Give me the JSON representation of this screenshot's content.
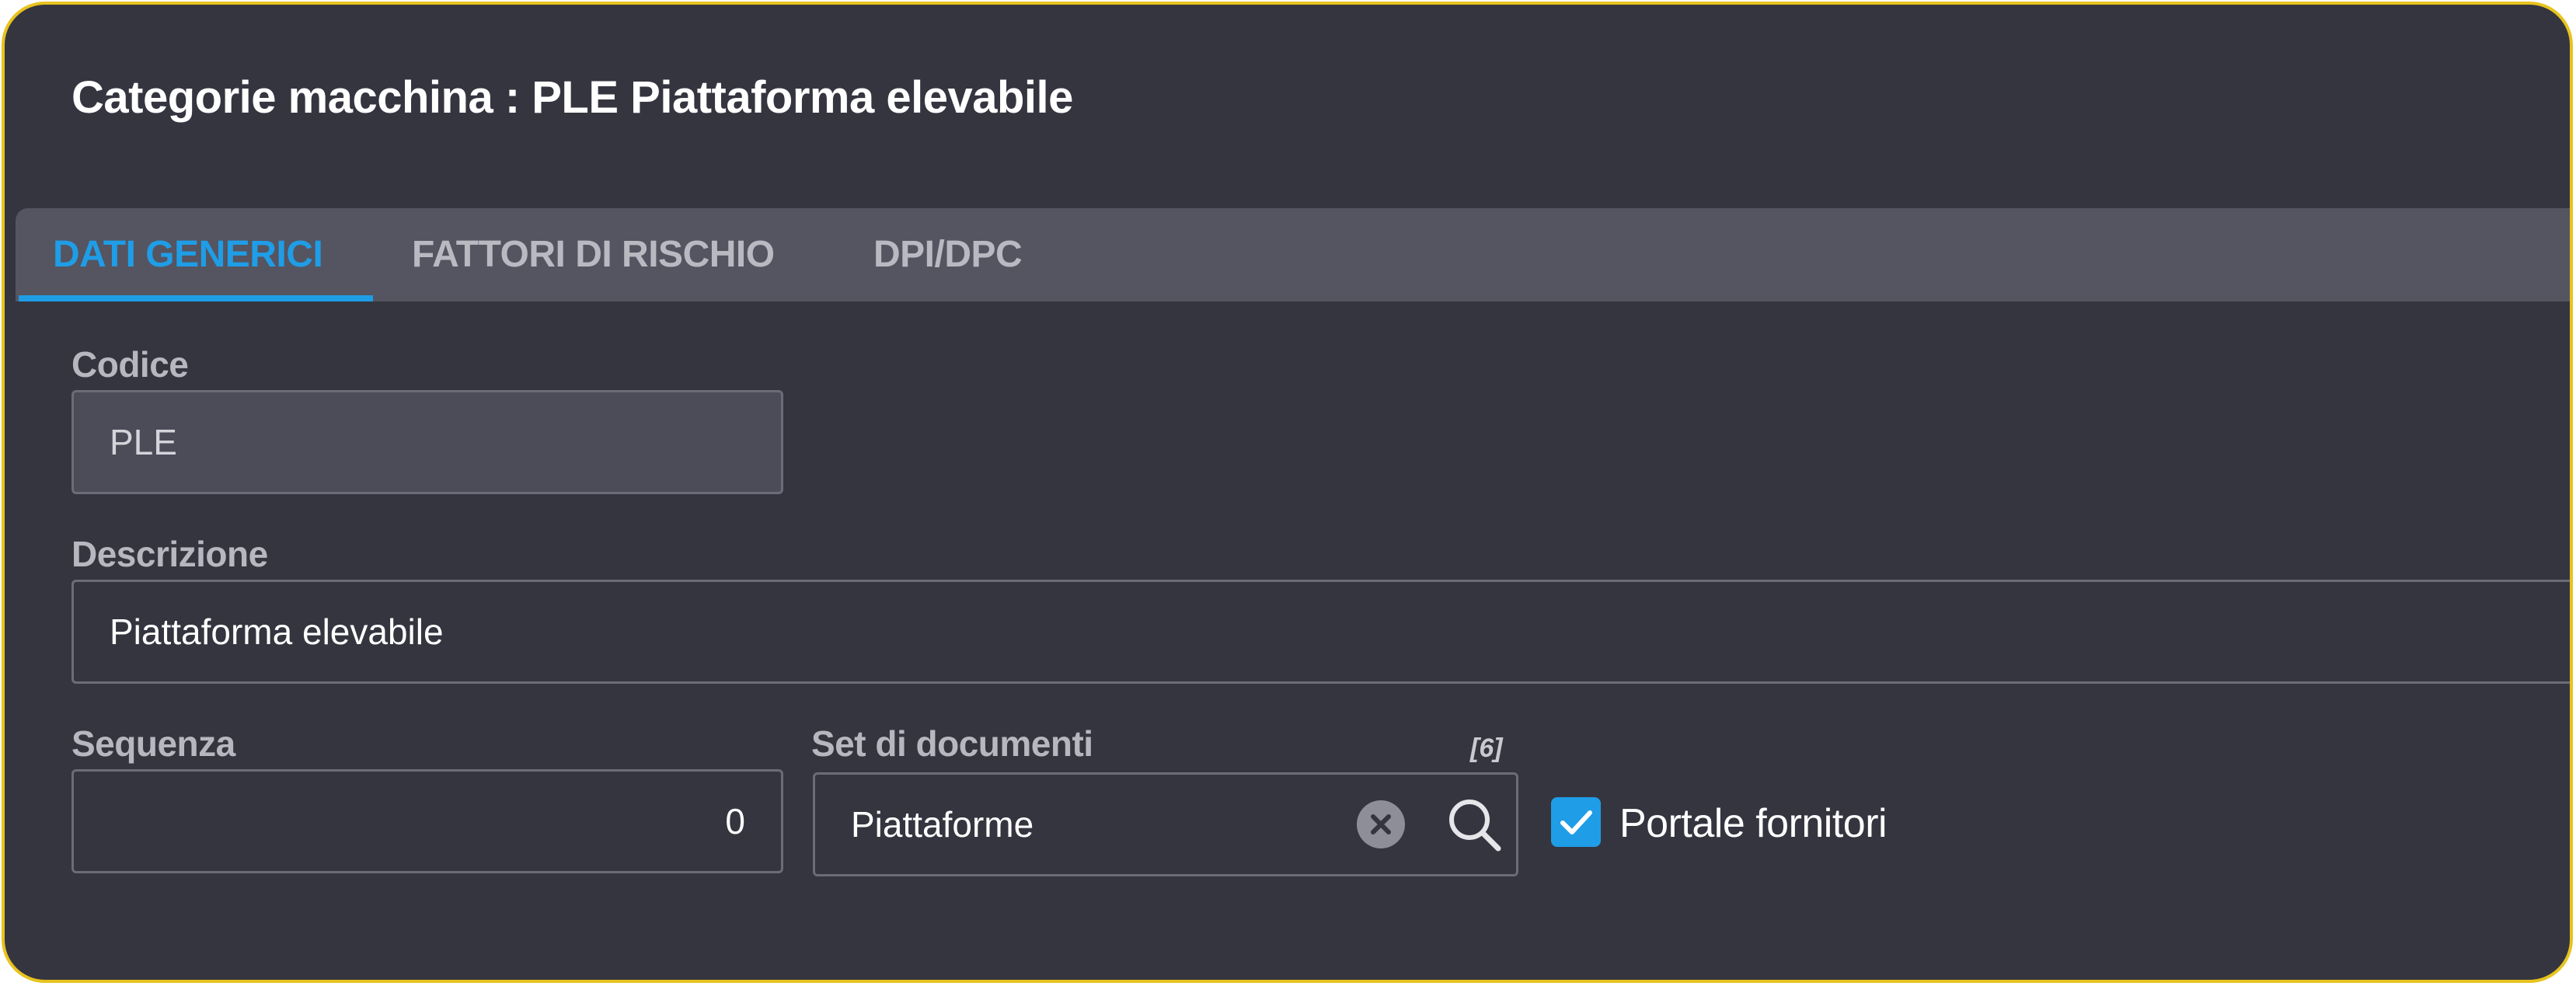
{
  "header": {
    "title": "Categorie macchina : PLE Piattaforma elevabile"
  },
  "tabs": [
    {
      "label": "DATI GENERICI",
      "active": true
    },
    {
      "label": "FATTORI DI RISCHIO",
      "active": false
    },
    {
      "label": "DPI/DPC",
      "active": false
    }
  ],
  "form": {
    "codice": {
      "label": "Codice",
      "value": "PLE"
    },
    "descrizione": {
      "label": "Descrizione",
      "value": "Piattaforma elevabile"
    },
    "sequenza": {
      "label": "Sequenza",
      "value": "0"
    },
    "set_documenti": {
      "label": "Set di documenti",
      "count": "[6]",
      "value": "Piattaforme"
    },
    "portale_fornitori": {
      "label": "Portale fornitori",
      "checked": true
    }
  },
  "icons": {
    "clear": "clear-icon",
    "search": "search-icon",
    "check": "check-icon"
  },
  "colors": {
    "accent": "#1f9de6",
    "border_highlight": "#e7c31e",
    "background": "#353540",
    "tabbar": "#555461"
  }
}
